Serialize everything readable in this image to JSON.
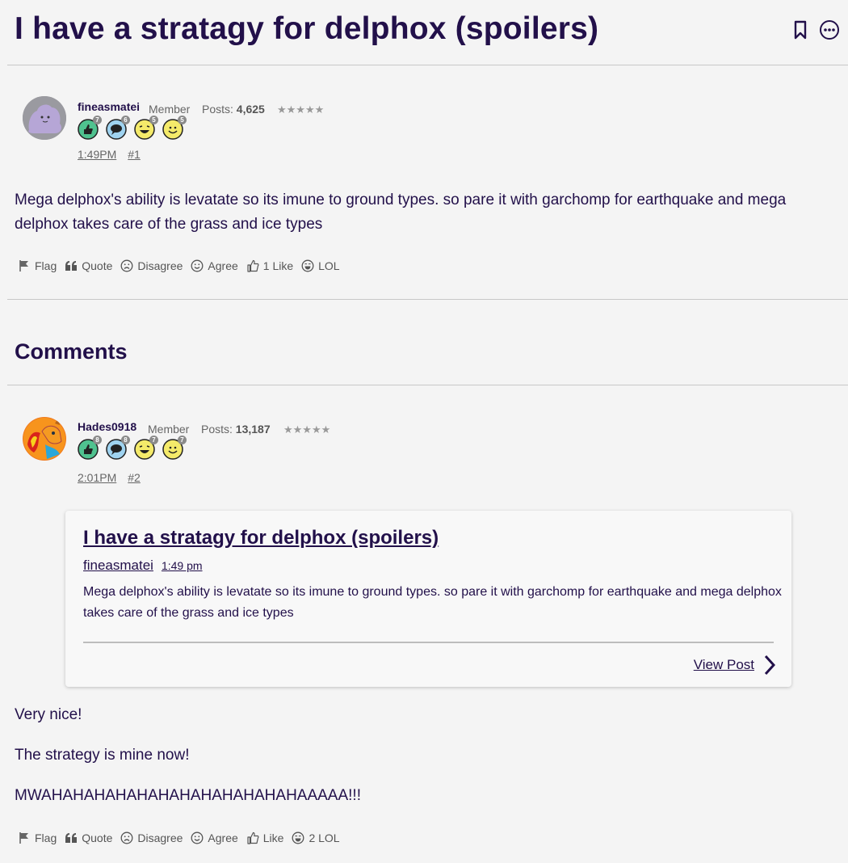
{
  "thread": {
    "title": "I have a stratagy for delphox (spoilers)"
  },
  "icons": {
    "bookmark": "bookmark-icon",
    "more": "more-options-icon"
  },
  "post1": {
    "username": "fineasmatei",
    "role": "Member",
    "posts_label": "Posts:",
    "posts_count": "4,625",
    "stars": "★★★★★",
    "badges": [
      "7",
      "6",
      "5",
      "5"
    ],
    "time": "1:49PM",
    "number": "#1",
    "body": "Mega delphox's ability is levatate so its imune to ground types. so pare it with garchomp for earthquake and mega delphox takes care of the grass and ice types",
    "actions": {
      "flag": "Flag",
      "quote": "Quote",
      "disagree": "Disagree",
      "agree": "Agree",
      "like": "1 Like",
      "lol": "LOL"
    }
  },
  "comments_heading": "Comments",
  "post2": {
    "username": "Hades0918",
    "role": "Member",
    "posts_label": "Posts:",
    "posts_count": "13,187",
    "stars": "★★★★★",
    "badges": [
      "8",
      "8",
      "7",
      "7"
    ],
    "time": "2:01PM",
    "number": "#2",
    "quote": {
      "title": "I have a stratagy for delphox (spoilers)",
      "author": "fineasmatei",
      "time": "1:49 pm",
      "text": "Mega delphox's ability is levatate so its imune to ground types. so pare it with garchomp for earthquake and mega delphox takes care of the grass and ice types",
      "view_post": "View Post"
    },
    "lines": [
      "Very nice!",
      "The strategy is mine now!",
      "MWAHAHAHAHAHAHAHAHAHAHAHAHAAAAA!!!"
    ],
    "actions": {
      "flag": "Flag",
      "quote": "Quote",
      "disagree": "Disagree",
      "agree": "Agree",
      "like": "Like",
      "lol": "2 LOL"
    }
  },
  "colors": {
    "text": "#22104a",
    "background": "#f4f4f4",
    "badge_green": "#4fc28f",
    "badge_blue": "#9fd3f0",
    "badge_yellow": "#f4ea6a"
  }
}
